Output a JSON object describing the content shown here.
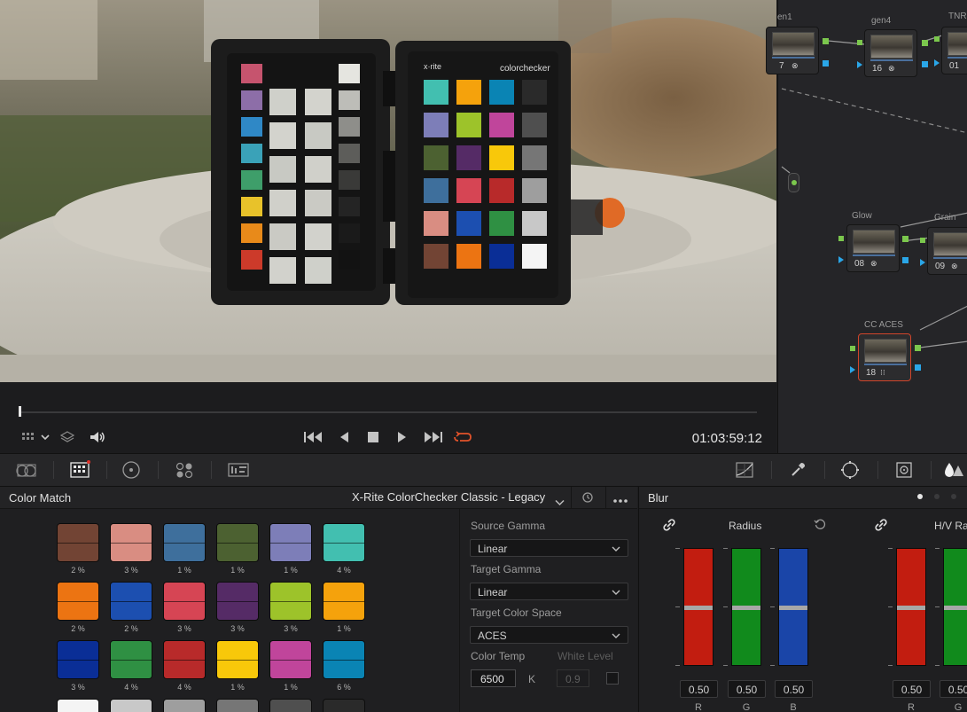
{
  "viewer": {
    "timecode": "01:03:59:12",
    "playhead_fraction": 0.0
  },
  "nodes": [
    {
      "label": "en1",
      "number": "7"
    },
    {
      "label": "gen4",
      "number": "16"
    },
    {
      "label": "TNR",
      "number": "01"
    },
    {
      "label": "Glow",
      "number": "08"
    },
    {
      "label": "Grain",
      "number": "09"
    },
    {
      "label": "CC ACES",
      "number": "18"
    }
  ],
  "color_match": {
    "title": "Color Match",
    "chart_preset": "X-Rite ColorChecker Classic - Legacy",
    "swatches": [
      {
        "top": "#724434",
        "bottom": "#724434",
        "pct": "2 %"
      },
      {
        "top": "#d98d82",
        "bottom": "#d98d82",
        "pct": "3 %"
      },
      {
        "top": "#3e6f9c",
        "bottom": "#3e6f9c",
        "pct": "1 %"
      },
      {
        "top": "#4c6131",
        "bottom": "#4c6131",
        "pct": "1 %"
      },
      {
        "top": "#7d7eb8",
        "bottom": "#7d7eb8",
        "pct": "1 %"
      },
      {
        "top": "#42bfb0",
        "bottom": "#42bfb0",
        "pct": "4 %"
      },
      {
        "top": "#ec7412",
        "bottom": "#ec7412",
        "pct": "2 %"
      },
      {
        "top": "#1c4fb0",
        "bottom": "#1c4fb0",
        "pct": "2 %"
      },
      {
        "top": "#d64554",
        "bottom": "#d64554",
        "pct": "3 %"
      },
      {
        "top": "#552b66",
        "bottom": "#552b66",
        "pct": "3 %"
      },
      {
        "top": "#9dc32a",
        "bottom": "#9dc32a",
        "pct": "3 %"
      },
      {
        "top": "#f5a20c",
        "bottom": "#f5a20c",
        "pct": "1 %"
      },
      {
        "top": "#0a2e96",
        "bottom": "#0a2e96",
        "pct": "3 %"
      },
      {
        "top": "#2f9043",
        "bottom": "#2f9043",
        "pct": "4 %"
      },
      {
        "top": "#b82a2a",
        "bottom": "#b82a2a",
        "pct": "4 %"
      },
      {
        "top": "#f8c80a",
        "bottom": "#f8c80a",
        "pct": "1 %"
      },
      {
        "top": "#c0459b",
        "bottom": "#c0459b",
        "pct": "1 %"
      },
      {
        "top": "#0a84b4",
        "bottom": "#0a84b4",
        "pct": "6 %"
      },
      {
        "top": "#f4f4f4",
        "bottom": "#f4f4f4",
        "pct": ""
      },
      {
        "top": "#c8c8c8",
        "bottom": "#c8c8c8",
        "pct": ""
      },
      {
        "top": "#9e9e9e",
        "bottom": "#9e9e9e",
        "pct": ""
      },
      {
        "top": "#767676",
        "bottom": "#767676",
        "pct": ""
      },
      {
        "top": "#4f4f4f",
        "bottom": "#4f4f4f",
        "pct": ""
      },
      {
        "top": "#2a2a2a",
        "bottom": "#2a2a2a",
        "pct": ""
      }
    ],
    "source_gamma_label": "Source Gamma",
    "source_gamma": "Linear",
    "target_gamma_label": "Target Gamma",
    "target_gamma": "Linear",
    "target_color_space_label": "Target Color Space",
    "target_color_space": "ACES",
    "color_temp_label": "Color Temp",
    "color_temp": "6500",
    "color_temp_unit": "K",
    "white_level_label": "White Level",
    "white_level": "0.9",
    "white_level_checked": false
  },
  "blur": {
    "title": "Blur",
    "radius_label": "Radius",
    "hv_label": "H/V Ra",
    "radius": [
      {
        "channel": "R",
        "value": "0.50",
        "color": "#c21d10"
      },
      {
        "channel": "G",
        "value": "0.50",
        "color": "#118a1c"
      },
      {
        "channel": "B",
        "value": "0.50",
        "color": "#1a45a8"
      }
    ],
    "hv": [
      {
        "channel": "R",
        "value": "0.50",
        "color": "#c21d10"
      },
      {
        "channel": "G",
        "value": "0.50",
        "color": "#118a1c"
      }
    ],
    "page_dots": 3,
    "active_page": 0
  },
  "colors": {
    "accent_red": "#e0522a",
    "port_green": "#7bc74d",
    "port_blue": "#2aa6e8"
  }
}
